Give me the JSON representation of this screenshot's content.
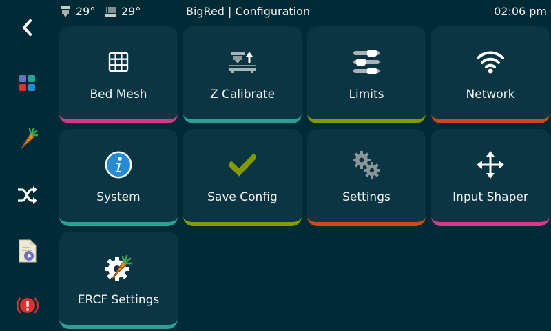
{
  "status": {
    "extruder_temp": "29°",
    "bed_temp": "29°",
    "title": "BigRed | Configuration",
    "time": "02:06 pm"
  },
  "sidebar": {
    "items": [
      {
        "icon": "back-chevron-icon",
        "id": "back"
      },
      {
        "icon": "home-grid-icon",
        "id": "home"
      },
      {
        "icon": "carrot-icon",
        "id": "ercf"
      },
      {
        "icon": "shuffle-icon",
        "id": "macros"
      },
      {
        "icon": "file-print-icon",
        "id": "print"
      },
      {
        "icon": "emergency-stop-icon",
        "id": "estop"
      }
    ]
  },
  "menu": {
    "tiles": [
      {
        "label": "Bed Mesh",
        "icon": "grid-icon",
        "accent": "#d13a8a"
      },
      {
        "label": "Z Calibrate",
        "icon": "z-offset-icon",
        "accent": "#2aa198"
      },
      {
        "label": "Limits",
        "icon": "sliders-icon",
        "accent": "#859900"
      },
      {
        "label": "Network",
        "icon": "wifi-icon",
        "accent": "#cb4b16"
      },
      {
        "label": "System",
        "icon": "info-icon",
        "accent": "#2aa198"
      },
      {
        "label": "Save Config",
        "icon": "checkmark-icon",
        "accent": "#859900"
      },
      {
        "label": "Settings",
        "icon": "gears-icon",
        "accent": "#cb4b16"
      },
      {
        "label": "Input Shaper",
        "icon": "move-arrows-icon",
        "accent": "#d13a8a"
      },
      {
        "label": "ERCF Settings",
        "icon": "ercf-gear-icon",
        "accent": "#2aa198"
      }
    ]
  },
  "colors": {
    "background": "#002b36",
    "tile": "#0b3542",
    "pink": "#d13a8a",
    "teal": "#2aa198",
    "green": "#859900",
    "orange": "#cb4b16"
  }
}
